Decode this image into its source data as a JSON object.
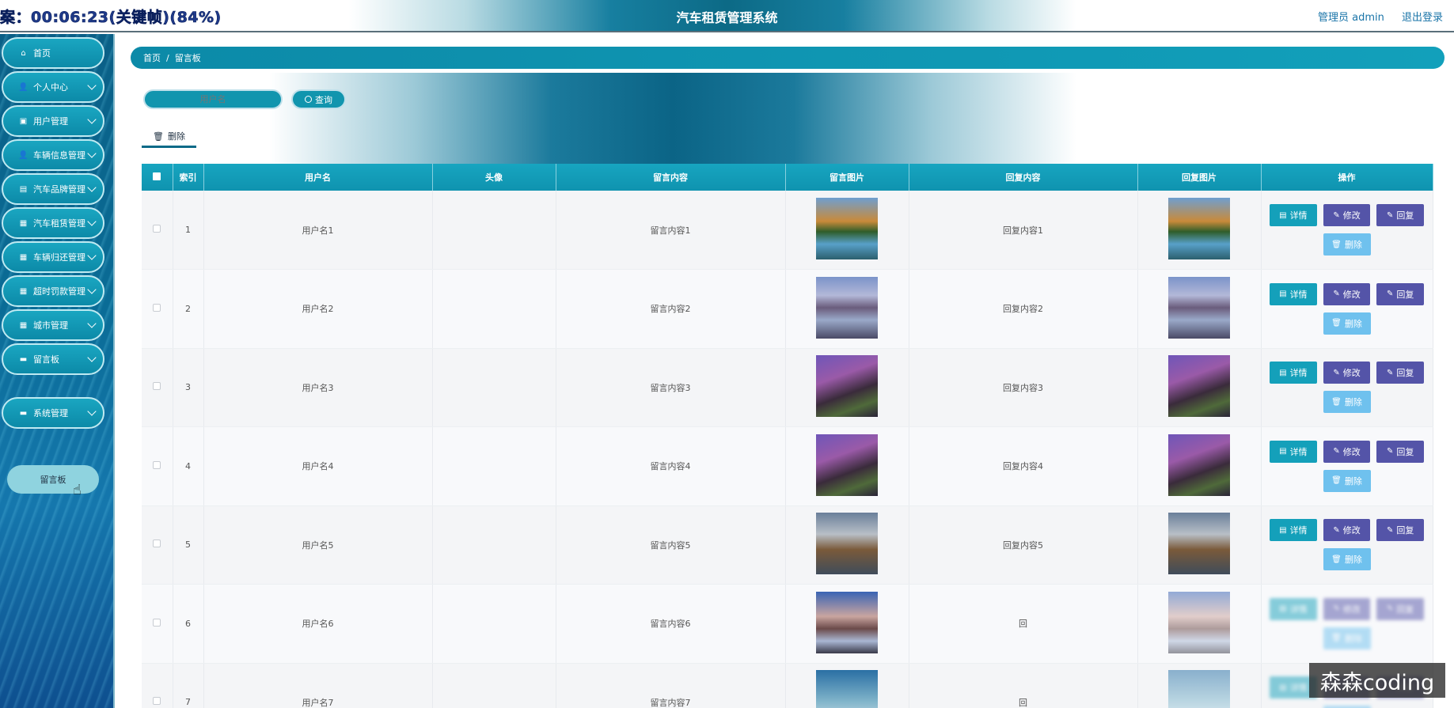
{
  "header": {
    "timer": "案：00:06:23(关键帧)(84%)",
    "title": "汽车租赁管理系统",
    "user": "管理员 admin",
    "logout": "退出登录"
  },
  "sidebar": {
    "items": [
      {
        "label": "首页",
        "icon": "home-icon",
        "chevron": false
      },
      {
        "label": "个人中心",
        "icon": "user-icon",
        "chevron": true
      },
      {
        "label": "用户管理",
        "icon": "briefcase-icon",
        "chevron": true
      },
      {
        "label": "车辆信息管理",
        "icon": "user-icon",
        "chevron": true
      },
      {
        "label": "汽车品牌管理",
        "icon": "clipboard-icon",
        "chevron": true
      },
      {
        "label": "汽车租赁管理",
        "icon": "grid-icon",
        "chevron": true
      },
      {
        "label": "车辆归还管理",
        "icon": "grid-icon",
        "chevron": true
      },
      {
        "label": "超时罚款管理",
        "icon": "grid-icon",
        "chevron": true
      },
      {
        "label": "城市管理",
        "icon": "grid-icon",
        "chevron": true
      },
      {
        "label": "留言板",
        "icon": "monitor-icon",
        "chevron": true
      },
      {
        "label": "系统管理",
        "icon": "monitor-icon",
        "chevron": true
      }
    ],
    "sub_item": "留言板"
  },
  "breadcrumb": {
    "home": "首页",
    "sep": "/",
    "current": "留言板"
  },
  "search": {
    "placeholder": "用户名",
    "button": "查询"
  },
  "toolbar": {
    "delete": "删除"
  },
  "table": {
    "columns": [
      "",
      "索引",
      "用户名",
      "头像",
      "留言内容",
      "留言图片",
      "回复内容",
      "回复图片",
      "操作"
    ],
    "rows": [
      {
        "index": "1",
        "username": "用户名1",
        "content": "留言内容1",
        "reply": "回复内容1",
        "img": "th-a"
      },
      {
        "index": "2",
        "username": "用户名2",
        "content": "留言内容2",
        "reply": "回复内容2",
        "img": "th-b"
      },
      {
        "index": "3",
        "username": "用户名3",
        "content": "留言内容3",
        "reply": "回复内容3",
        "img": "th-c"
      },
      {
        "index": "4",
        "username": "用户名4",
        "content": "留言内容4",
        "reply": "回复内容4",
        "img": "th-c"
      },
      {
        "index": "5",
        "username": "用户名5",
        "content": "留言内容5",
        "reply": "回复内容5",
        "img": "th-d"
      },
      {
        "index": "6",
        "username": "用户名6",
        "content": "留言内容6",
        "reply": "回",
        "img": "th-e"
      },
      {
        "index": "7",
        "username": "用户名7",
        "content": "留言内容7",
        "reply": "回",
        "img": "th-f"
      }
    ],
    "actions": {
      "detail": "详情",
      "edit": "修改",
      "reply": "回复",
      "delete": "删除"
    }
  },
  "watermark": "森森coding"
}
